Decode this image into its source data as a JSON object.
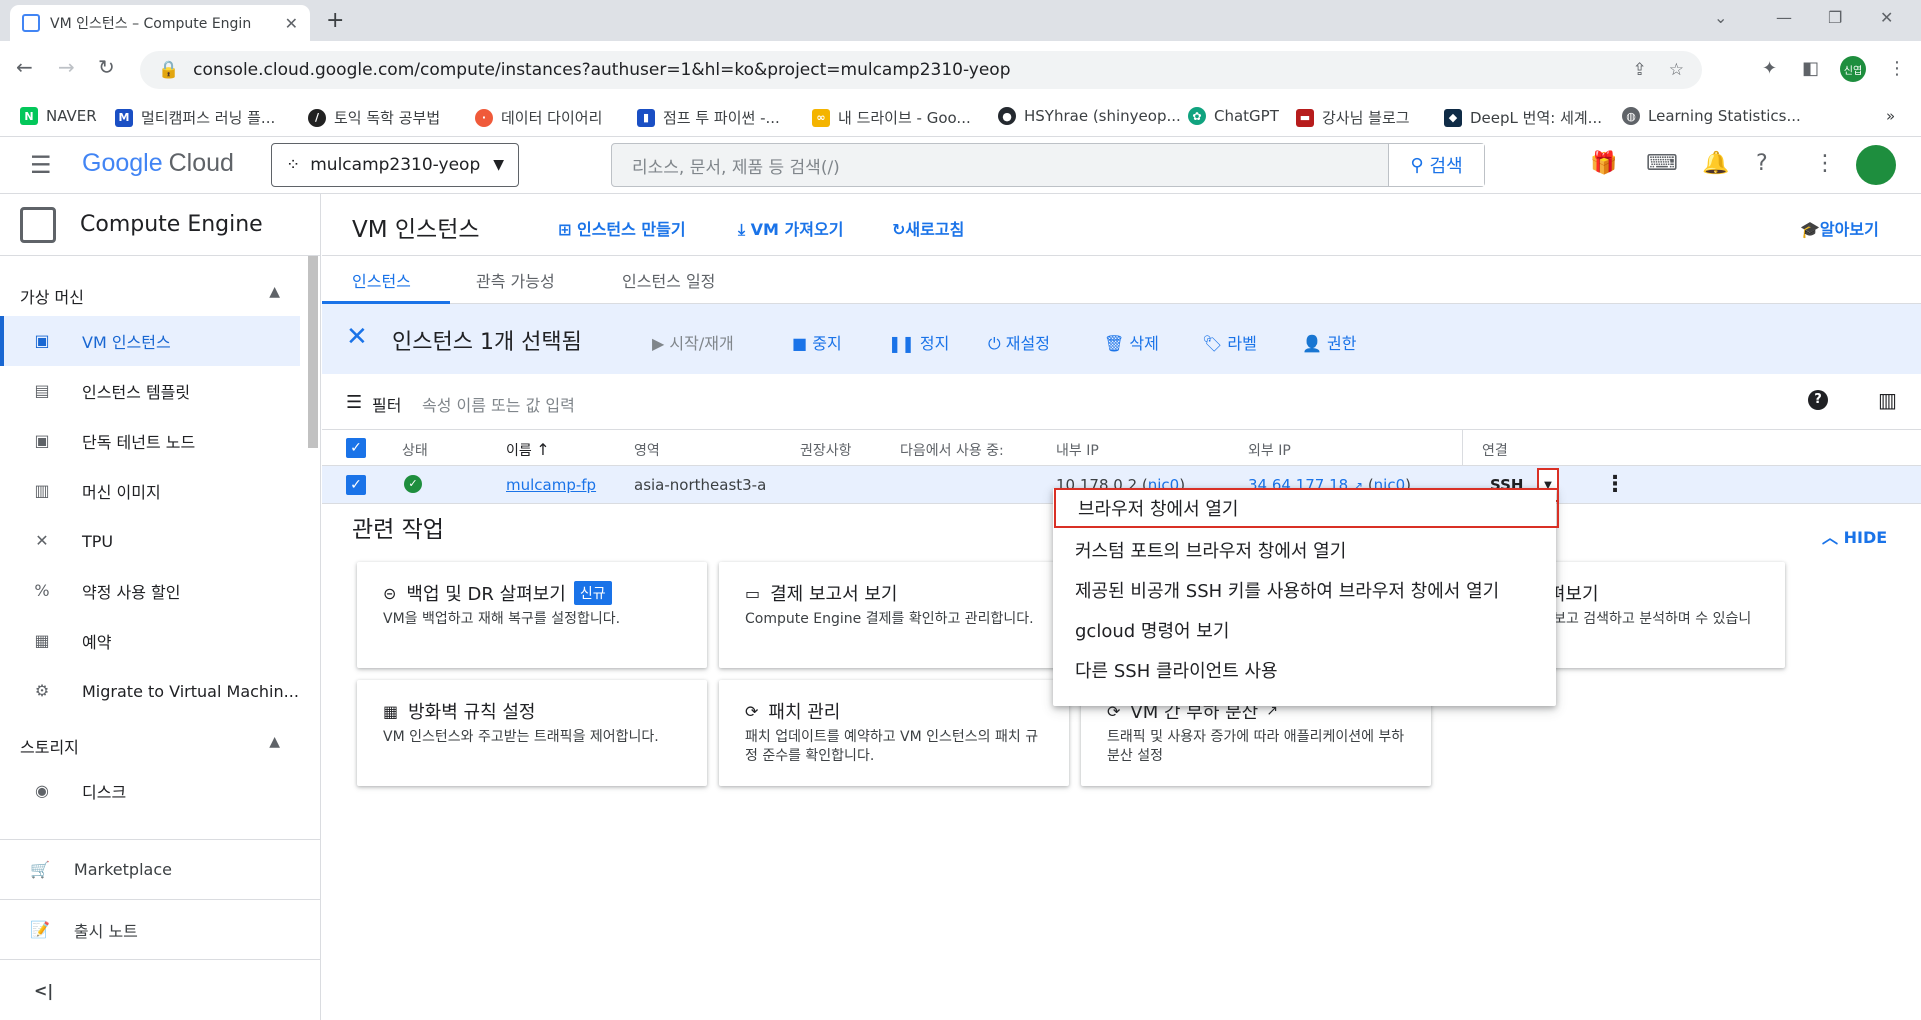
{
  "browser": {
    "tab_title": "VM 인스턴스 – Compute Engin",
    "url": "console.cloud.google.com/compute/instances?authuser=1&hl=ko&project=mulcamp2310-yeop",
    "profile_label": "신엽"
  },
  "bookmarks": [
    {
      "label": "NAVER",
      "icon": "naver-icon",
      "color": "#03c75a"
    },
    {
      "label": "멀티캠퍼스 러닝 플...",
      "icon": "multicampus-icon",
      "color": "#1a4fc4"
    },
    {
      "label": "토익 독학 공부법",
      "icon": "toeic-icon",
      "color": "#222222"
    },
    {
      "label": "데이터 다이어리",
      "icon": "data-diary-icon",
      "color": "#f05a3a"
    },
    {
      "label": "점프 투 파이썬 -...",
      "icon": "jump-to-python-icon",
      "color": "#1a4fc4"
    },
    {
      "label": "내 드라이브 - Goo...",
      "icon": "drive-icon",
      "color": "#f4b400"
    },
    {
      "label": "HSYhrae (shinyeop...",
      "icon": "github-icon",
      "color": "#24292f"
    },
    {
      "label": "ChatGPT",
      "icon": "chatgpt-icon",
      "color": "#10a37f"
    },
    {
      "label": "강사님 블로그",
      "icon": "blog-icon",
      "color": "#b71c1c"
    },
    {
      "label": "DeepL 번역: 세계...",
      "icon": "deepl-icon",
      "color": "#0f2b46"
    },
    {
      "label": "Learning Statistics...",
      "icon": "globe-icon",
      "color": "#5f6368"
    }
  ],
  "header": {
    "logo_google": "Google",
    "logo_cloud": "Cloud",
    "project": "mulcamp2310-yeop",
    "search_placeholder": "리소스, 문서, 제품 등 검색(/)",
    "search_button": "검색"
  },
  "sidebar": {
    "product": "Compute Engine",
    "section_vm": "가상 머신",
    "items": [
      {
        "label": "VM 인스턴스",
        "icon": "vm-instance-icon",
        "glyph": "▣",
        "active": true
      },
      {
        "label": "인스턴스 템플릿",
        "icon": "template-icon",
        "glyph": "▤",
        "active": false
      },
      {
        "label": "단독 테넌트 노드",
        "icon": "sole-tenant-icon",
        "glyph": "▣",
        "active": false
      },
      {
        "label": "머신 이미지",
        "icon": "machine-image-icon",
        "glyph": "▥",
        "active": false
      },
      {
        "label": "TPU",
        "icon": "tpu-icon",
        "glyph": "✕",
        "active": false
      },
      {
        "label": "약정 사용 할인",
        "icon": "discount-icon",
        "glyph": "%",
        "active": false
      },
      {
        "label": "예약",
        "icon": "reservation-icon",
        "glyph": "▦",
        "active": false
      },
      {
        "label": "Migrate to Virtual Machin...",
        "icon": "migrate-icon",
        "glyph": "⚙",
        "active": false
      }
    ],
    "section_storage": "스토리지",
    "storage_items": [
      {
        "label": "디스크",
        "icon": "disk-icon",
        "glyph": "◉"
      }
    ],
    "marketplace": "Marketplace",
    "release_notes": "출시 노트",
    "collapse": "<|"
  },
  "main": {
    "title": "VM 인스턴스",
    "actions": {
      "create": "인스턴스 만들기",
      "import": "VM 가져오기",
      "refresh": "새로고침",
      "learn": "알아보기"
    },
    "tabs": [
      "인스턴스",
      "관측 가능성",
      "인스턴스 일정"
    ],
    "selection": {
      "text": "인스턴스 1개 선택됨",
      "start": "시작/재개",
      "stop": "중지",
      "suspend": "정지",
      "reset": "재설정",
      "delete": "삭제",
      "label": "라벨",
      "permissions": "권한"
    },
    "filter": {
      "label": "필터",
      "placeholder": "속성 이름 또는 값 입력"
    },
    "columns": {
      "status": "상태",
      "name": "이름",
      "zone": "영역",
      "recommendation": "권장사항",
      "in_use_by": "다음에서 사용 중:",
      "internal_ip": "내부 IP",
      "external_ip": "외부 IP",
      "connect": "연결"
    },
    "row": {
      "name": "mulcamp-fp",
      "zone": "asia-northeast3-a",
      "internal_ip": "10.178.0.2",
      "internal_nic": "nic0",
      "external_ip": "34.64.177.18",
      "external_nic": "nic0",
      "connect": "SSH"
    },
    "related": {
      "title": "관련 작업",
      "hide": "HIDE",
      "cards": [
        {
          "title": "백업 및 DR 살펴보기",
          "badge": "신규",
          "desc": "VM을 백업하고 재해 복구를 설정합니다."
        },
        {
          "title": "결제 보고서 보기",
          "desc": "Compute Engine 결제를 확인하고 관리합니다."
        },
        {
          "title": "그 살펴보기",
          "desc": "로그를 보고 검색하고 분석하며 수 있습니다."
        },
        {
          "title": "방화벽 규칙 설정",
          "desc": "VM 인스턴스와 주고받는 트래픽을 제어합니다."
        },
        {
          "title": "패치 관리",
          "desc": "패치 업데이트를 예약하고 VM 인스턴스의 패치 규정 준수를 확인합니다."
        },
        {
          "title": "VM 간 부하 분산",
          "desc": "트래픽 및 사용자 증가에 따라 애플리케이션에 부하 분산 설정"
        }
      ]
    }
  },
  "ssh_menu": [
    "브라우저 창에서 열기",
    "커스텀 포트의 브라우저 창에서 열기",
    "제공된 비공개 SSH 키를 사용하여 브라우저 창에서 열기",
    "gcloud 명령어 보기",
    "다른 SSH 클라이언트 사용"
  ]
}
